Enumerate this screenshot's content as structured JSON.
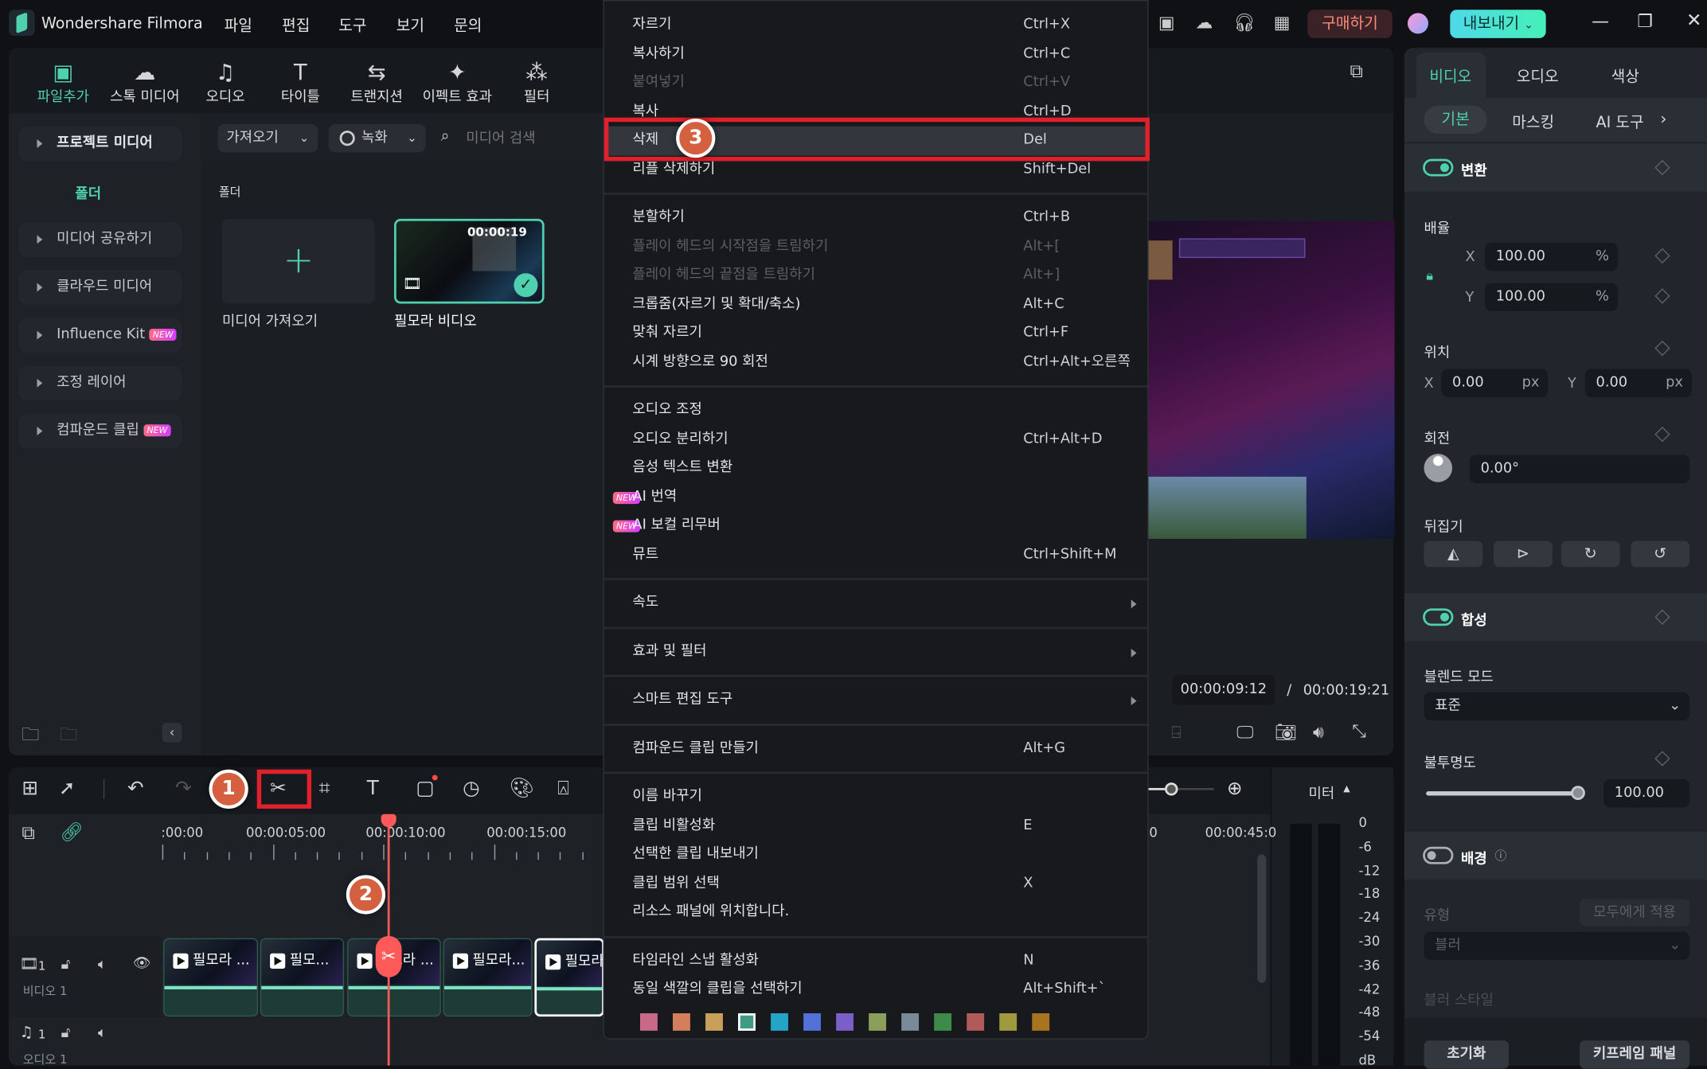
{
  "app": {
    "title": "Wondershare Filmora",
    "menus": [
      "파일",
      "편집",
      "도구",
      "보기",
      "문의"
    ],
    "buy_label": "구매하기",
    "export_label": "내보내기",
    "accent": "#4fd1b0"
  },
  "toolbar": {
    "tabs": [
      {
        "label": "파일추가",
        "icon": "image-icon",
        "active": true
      },
      {
        "label": "스톡 미디어",
        "icon": "cloud-folder-icon"
      },
      {
        "label": "오디오",
        "icon": "music-note-icon"
      },
      {
        "label": "타이틀",
        "icon": "text-t-icon"
      },
      {
        "label": "트랜지션",
        "icon": "transition-icon"
      },
      {
        "label": "이펙트 효과",
        "icon": "sparkle-icon"
      },
      {
        "label": "필터",
        "icon": "filter-circles-icon"
      }
    ]
  },
  "sidebar": {
    "project_media": "프로젝트 미디어",
    "folder": "폴더",
    "items": [
      {
        "label": "미디어 공유하기"
      },
      {
        "label": "클라우드 미디어"
      },
      {
        "label": "Influence Kit",
        "new": "NEW"
      },
      {
        "label": "조정 레이어"
      },
      {
        "label": "컴파운드 클립",
        "new": "NEW"
      }
    ]
  },
  "media": {
    "import_dropdown": "가져오기",
    "record_dropdown": "녹화",
    "search_placeholder": "미디어 검색",
    "folder_label": "폴더",
    "import_tile": "미디어 가져오기",
    "video_tile": {
      "name": "필모라 비디오",
      "duration": "00:00:19"
    }
  },
  "preview": {
    "current_time": "00:00:09:12",
    "separator": "/",
    "total_time": "00:00:19:21"
  },
  "context_menu": {
    "groups": [
      [
        {
          "label": "자르기",
          "shortcut": "Ctrl+X"
        },
        {
          "label": "복사하기",
          "shortcut": "Ctrl+C"
        },
        {
          "label": "붙여넣기",
          "shortcut": "Ctrl+V",
          "disabled": true
        },
        {
          "label": "복사",
          "shortcut": "Ctrl+D"
        },
        {
          "label": "삭제",
          "shortcut": "Del",
          "highlighted": true
        },
        {
          "label": "리플 삭제하기",
          "shortcut": "Shift+Del"
        }
      ],
      [
        {
          "label": "분할하기",
          "shortcut": "Ctrl+B"
        },
        {
          "label": "플레이 헤드의 시작점을 트림하기",
          "shortcut": "Alt+[",
          "disabled": true
        },
        {
          "label": "플레이 헤드의 끝점을 트림하기",
          "shortcut": "Alt+]",
          "disabled": true
        },
        {
          "label": "크롭줌(자르기 및 확대/축소)",
          "shortcut": "Alt+C"
        },
        {
          "label": "맞춰 자르기",
          "shortcut": "Ctrl+F"
        },
        {
          "label": "시계 방향으로 90 회전",
          "shortcut": "Ctrl+Alt+오른쪽"
        }
      ],
      [
        {
          "label": "오디오 조정"
        },
        {
          "label": "오디오 분리하기",
          "shortcut": "Ctrl+Alt+D"
        },
        {
          "label": "음성 텍스트 변환"
        },
        {
          "label": "AI 번역",
          "new": "NEW"
        },
        {
          "label": "AI 보컬 리무버",
          "new": "NEW"
        },
        {
          "label": "뮤트",
          "shortcut": "Ctrl+Shift+M"
        }
      ],
      [
        {
          "label": "속도",
          "submenu": true
        }
      ],
      [
        {
          "label": "효과 및 필터",
          "submenu": true
        }
      ],
      [
        {
          "label": "스마트 편집 도구",
          "submenu": true
        }
      ],
      [
        {
          "label": "컴파운드 클립 만들기",
          "shortcut": "Alt+G"
        }
      ],
      [
        {
          "label": "이름 바꾸기"
        },
        {
          "label": "클립 비활성화",
          "shortcut": "E"
        },
        {
          "label": "선택한 클립 내보내기"
        },
        {
          "label": "클립 범위 선택",
          "shortcut": "X"
        },
        {
          "label": "리소스 패널에 위치합니다."
        }
      ],
      [
        {
          "label": "타임라인 스냅 활성화",
          "shortcut": "N"
        },
        {
          "label": "동일 색깔의 클립을 선택하기",
          "shortcut": "Alt+Shift+`"
        }
      ]
    ],
    "color_swatches": [
      "#c8698a",
      "#d47f5c",
      "#c9a05a",
      "#3f9b84",
      "#23a5c8",
      "#5271d9",
      "#7a5fc8",
      "#8b9e5a",
      "#7a8a99",
      "#3e8a4a",
      "#b05a5a",
      "#a09a3e",
      "#a87420"
    ],
    "selected_swatch": 3
  },
  "annotations": {
    "step1": "1",
    "step2": "2",
    "step3": "3",
    "highlight_color": "#e0202a",
    "badge_color": "#d4603f"
  },
  "timeline": {
    "ruler": [
      ":00:00",
      "00:00:05:00",
      "00:00:10:00",
      "00:00:15:00",
      "00",
      "00:00:45:0"
    ],
    "video_track": {
      "index": "1",
      "name": "비디오 1"
    },
    "audio_track": {
      "index": "1",
      "name": "오디오 1"
    },
    "clips": [
      "필모라 ...",
      "필모...",
      "필모라 ...",
      "필모라...",
      "필모라"
    ],
    "meter_label": "미터",
    "meter_scale": [
      "0",
      "-6",
      "-12",
      "-18",
      "-24",
      "-30",
      "-36",
      "-42",
      "-48",
      "-54",
      "dB"
    ]
  },
  "properties": {
    "tabs": [
      "비디오",
      "오디오",
      "색상"
    ],
    "subtabs": [
      "기본",
      "마스킹",
      "AI 도구"
    ],
    "transform": {
      "title": "변환",
      "enabled": true,
      "scale_label": "배율",
      "scale_x": "100.00",
      "scale_y": "100.00",
      "pct": "%",
      "x": "X",
      "y": "Y",
      "position_label": "위치",
      "pos_x": "0.00",
      "pos_y": "0.00",
      "px": "px",
      "rotation_label": "회전",
      "rotation": "0.00°",
      "flip_label": "뒤집기"
    },
    "composite": {
      "title": "합성",
      "enabled": true,
      "blend_label": "블렌드 모드",
      "blend_value": "표준",
      "opacity_label": "불투명도",
      "opacity": "100.00",
      "opacity_fraction": 1.0
    },
    "background": {
      "title": "배경",
      "enabled": false,
      "type_label": "유형",
      "apply_all": "모두에게 적용",
      "type_value": "블러",
      "style_label": "블러 스타일"
    },
    "reset": "초기화",
    "keyframe_panel": "키프레임 패널"
  }
}
